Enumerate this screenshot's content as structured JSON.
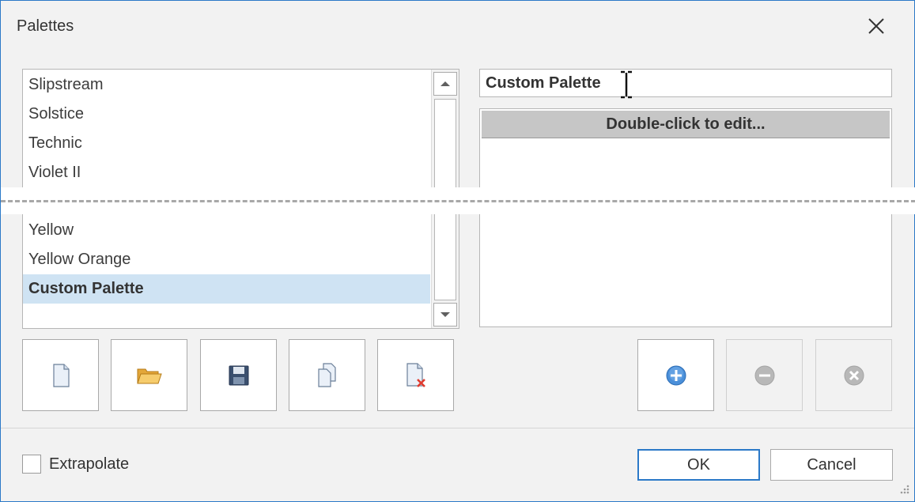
{
  "dialog": {
    "title": "Palettes",
    "close_icon": "close-icon"
  },
  "palette_list": {
    "items_top": [
      "Slipstream",
      "Solstice",
      "Technic",
      "Violet II"
    ],
    "items_bottom": [
      "Yellow",
      "Yellow Orange",
      "Custom Palette"
    ],
    "selected": "Custom Palette"
  },
  "palette_name": {
    "value": "Custom Palette"
  },
  "color_grid": {
    "header": "Double-click to edit..."
  },
  "palette_tools": [
    "new-palette-icon",
    "open-folder-icon",
    "save-icon",
    "copy-icon",
    "delete-palette-icon"
  ],
  "color_tools": {
    "add": "add-icon",
    "remove": "remove-icon",
    "clear": "clear-icon"
  },
  "extrapolate": {
    "label": "Extrapolate",
    "checked": false
  },
  "buttons": {
    "ok": "OK",
    "cancel": "Cancel"
  },
  "colors": {
    "accent": "#2b79c8",
    "selection": "#cfe3f3",
    "grid_header": "#c6c6c6"
  }
}
